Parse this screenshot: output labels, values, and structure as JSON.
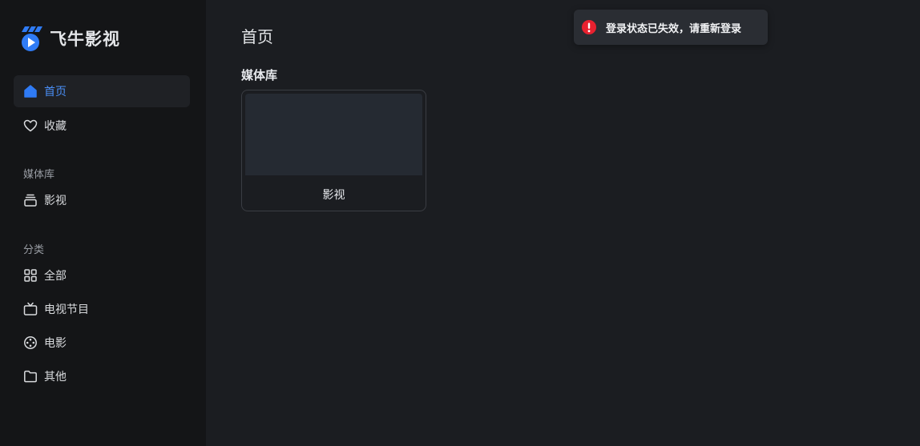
{
  "brand": {
    "name": "飞牛影视",
    "accent_color": "#2f7bf5"
  },
  "sidebar": {
    "top_items": [
      {
        "label": "首页",
        "icon": "home-icon",
        "active": true
      },
      {
        "label": "收藏",
        "icon": "heart-icon",
        "active": false
      }
    ],
    "media_section_title": "媒体库",
    "media_items": [
      {
        "label": "影视",
        "icon": "stack-icon"
      }
    ],
    "category_section_title": "分类",
    "category_items": [
      {
        "label": "全部",
        "icon": "grid-icon"
      },
      {
        "label": "电视节目",
        "icon": "tv-icon"
      },
      {
        "label": "电影",
        "icon": "film-reel-icon"
      },
      {
        "label": "其他",
        "icon": "folder-icon"
      }
    ]
  },
  "main": {
    "page_title": "首页",
    "library_heading": "媒体库",
    "library_cards": [
      {
        "label": "影视"
      }
    ]
  },
  "toast": {
    "message": "登录状态已失效，请重新登录",
    "icon": "error-icon",
    "icon_color": "#e8212f"
  }
}
